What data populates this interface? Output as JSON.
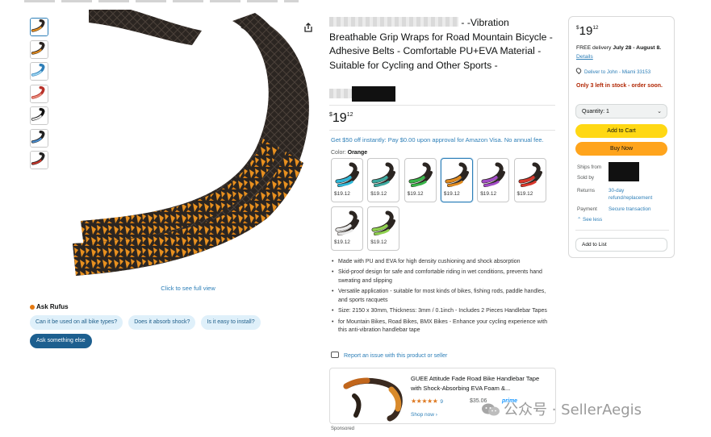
{
  "gallery": {
    "thumbnails": [
      "orange",
      "black-orange",
      "blue-pattern",
      "red-pattern",
      "black-white",
      "black-blue",
      "black-red"
    ],
    "full_view": "Click to see full view"
  },
  "rufus": {
    "label": "Ask Rufus",
    "chips": [
      "Can it be used on all bike types?",
      "Does it absorb shock?",
      "Is it easy to install?"
    ],
    "ask_else": "Ask something else"
  },
  "product": {
    "title_line1_end": "- -Vibration",
    "title_rest": "Breathable Grip Wraps for Road Mountain Bicycle - Adhesive Belts - Comfortable PU+EVA Material - Suitable for Cycling and Other Sports -",
    "price_whole": "19",
    "price_fraction": "12",
    "currency": "$",
    "offer": "Get $50 off instantly: Pay $0.00 upon approval for Amazon Visa. No annual fee.",
    "color_label": "Color:",
    "color_value": "Orange",
    "swatches": [
      {
        "price": "$19.12",
        "accent": "#2fb7d8"
      },
      {
        "price": "$19.12",
        "accent": "#3ca89e"
      },
      {
        "price": "$19.12",
        "accent": "#39b54a"
      },
      {
        "price": "$19.12",
        "accent": "#e08a1e"
      },
      {
        "price": "$19.12",
        "accent": "#a24bc6"
      },
      {
        "price": "$19.12",
        "accent": "#d9362b"
      },
      {
        "price": "$19.12",
        "accent": "#e9e9e9"
      },
      {
        "price": "$19.12",
        "accent": "#8fd14f"
      }
    ],
    "bullets": [
      "Made with PU and EVA for high density cushioning and shock absorption",
      "Skid-proof design for safe and comfortable riding in wet conditions, prevents hand sweating and slipping",
      "Versatile application - suitable for most kinds of bikes, fishing rods, paddle handles, and sports racquets",
      "Size: 2150 x 30mm, Thickness: 3mm / 0.1inch - Includes 2 Pieces Handlebar Tapes",
      "for Mountain Bikes, Road Bikes, BMX Bikes - Enhance your cycling experience with this anti-vibration handlebar tape"
    ],
    "report": "Report an issue with this product or seller"
  },
  "sponsored": {
    "title": "GUEE Attitude Fade Road Bike Handlebar Tape with Shock-Absorbing EVA Foam &...",
    "stars": "★★★★★",
    "rating_count": "9",
    "price": "$35.06",
    "prime": "prime",
    "shop": "Shop now ›",
    "label": "Sponsored"
  },
  "buybox": {
    "currency": "$",
    "price_whole": "19",
    "price_fraction": "12",
    "delivery_prefix": "FREE delivery",
    "delivery_dates": "July 28 - August 8.",
    "details": "Details",
    "deliver_to": "Deliver to John - Miami 33153",
    "stock": "Only 3 left in stock - order soon.",
    "quantity": "Quantity: 1",
    "add_to_cart": "Add to Cart",
    "buy_now": "Buy Now",
    "ships_from_label": "Ships from",
    "sold_by_label": "Sold by",
    "returns_label": "Returns",
    "returns_value": "30-day refund/replacement",
    "payment_label": "Payment",
    "payment_value": "Secure transaction",
    "see_less": "See less",
    "add_to_list": "Add to List"
  },
  "watermark": {
    "text": "公众号 · SellerAegis"
  },
  "colors": {
    "link": "#2d7fb8",
    "cart": "#ffd814",
    "buy": "#ffa41c",
    "stock": "#b12704",
    "tape_orange": "#e8901f",
    "tape_black": "#2a2522"
  }
}
